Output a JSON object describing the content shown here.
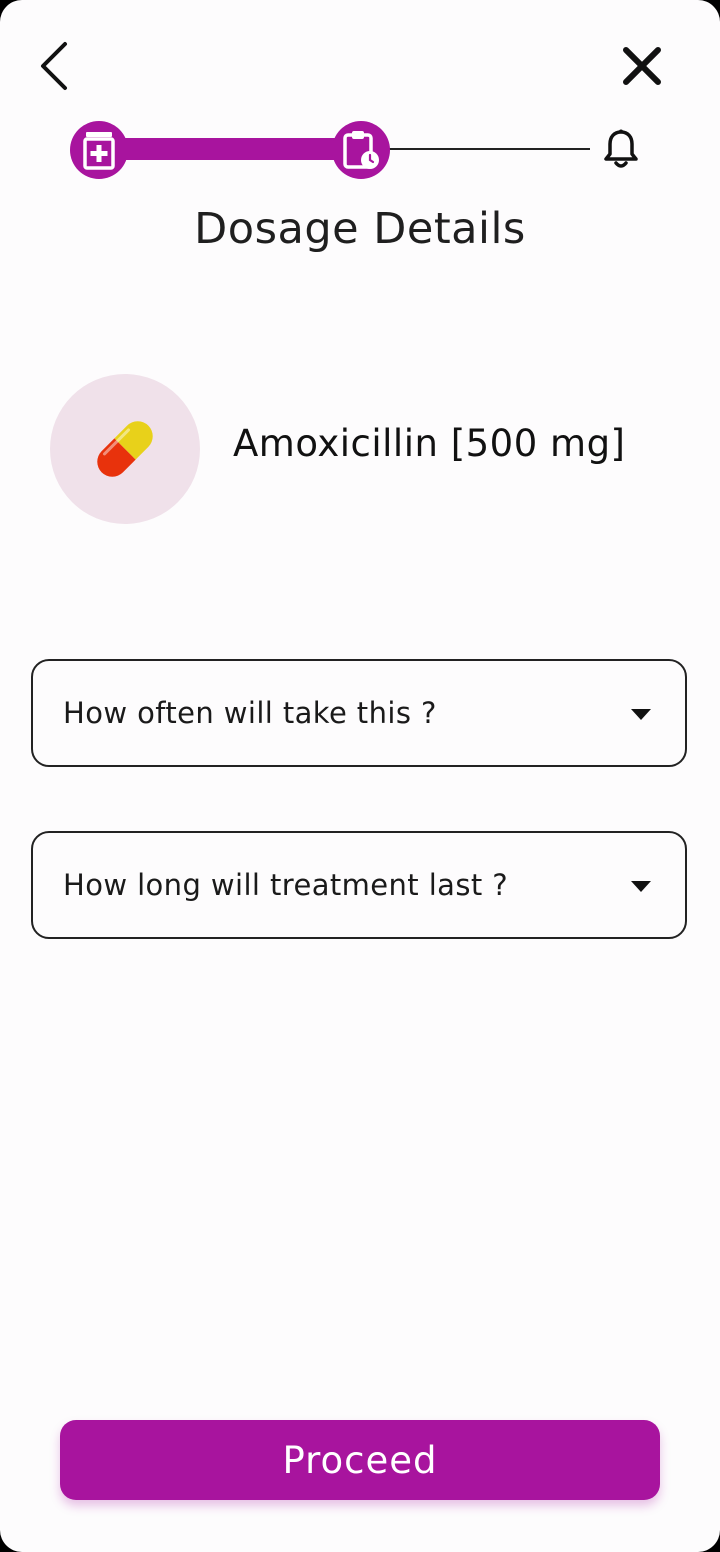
{
  "header": {
    "back_icon": "chevron-left-icon",
    "close_icon": "close-icon"
  },
  "stepper": {
    "steps": [
      {
        "icon": "medicine-box-icon",
        "state": "done"
      },
      {
        "icon": "clipboard-clock-icon",
        "state": "current"
      },
      {
        "icon": "bell-icon",
        "state": "pending"
      }
    ],
    "accent": "#a8149e"
  },
  "page": {
    "title": "Dosage Details"
  },
  "medication": {
    "name": "Amoxicillin [500 mg]",
    "icon": "capsule-icon"
  },
  "form": {
    "frequency_placeholder": "How often will take this ?",
    "duration_placeholder": "How long will treatment last ?"
  },
  "actions": {
    "proceed_label": "Proceed"
  }
}
